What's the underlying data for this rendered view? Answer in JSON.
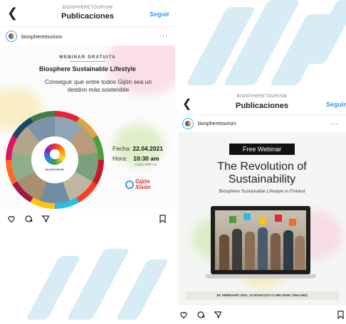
{
  "post1": {
    "header": {
      "account_caption": "BIOSPHERETOURISM",
      "title": "Publicaciones",
      "follow": "Seguir"
    },
    "account": {
      "username": "biospheretourism",
      "more": "···"
    },
    "image": {
      "eyebrow": "WEBINAR GRATUITA",
      "title": "Biosphere Sustainable Lifestyle",
      "desc_line1": "Conseguir que entre todos Gijón sea un",
      "desc_line2": "destino más sostenible",
      "date_label": "Fecha:",
      "date_value": "22.04.2021",
      "time_label": "Hora:",
      "time_value": "10:30 am",
      "time_zone": "(Gijón GMT+1)",
      "wheel_text": "BIOSPHERE",
      "logo_text_1": "Gijón",
      "logo_text_2": "Xixón"
    }
  },
  "post2": {
    "header": {
      "account_caption": "BIOSPHERETOURISM",
      "title": "Publicaciones",
      "follow": "Seguir"
    },
    "account": {
      "username": "biospheretourism",
      "more": "···"
    },
    "image": {
      "band": "Free Webinar",
      "title_line1": "The Revolution of",
      "title_line2": "Sustainability",
      "subtitle": "Biosphere Sustainable Lifestyle in Finland",
      "footer": "16. FEBRUARY 2021, 10:00AM (UTC+2 HELSINKI, FINLAND)"
    }
  },
  "colors": {
    "follow": "#3897f0",
    "accent_red": "#d32f2f",
    "deco": "#d8ecf6"
  }
}
